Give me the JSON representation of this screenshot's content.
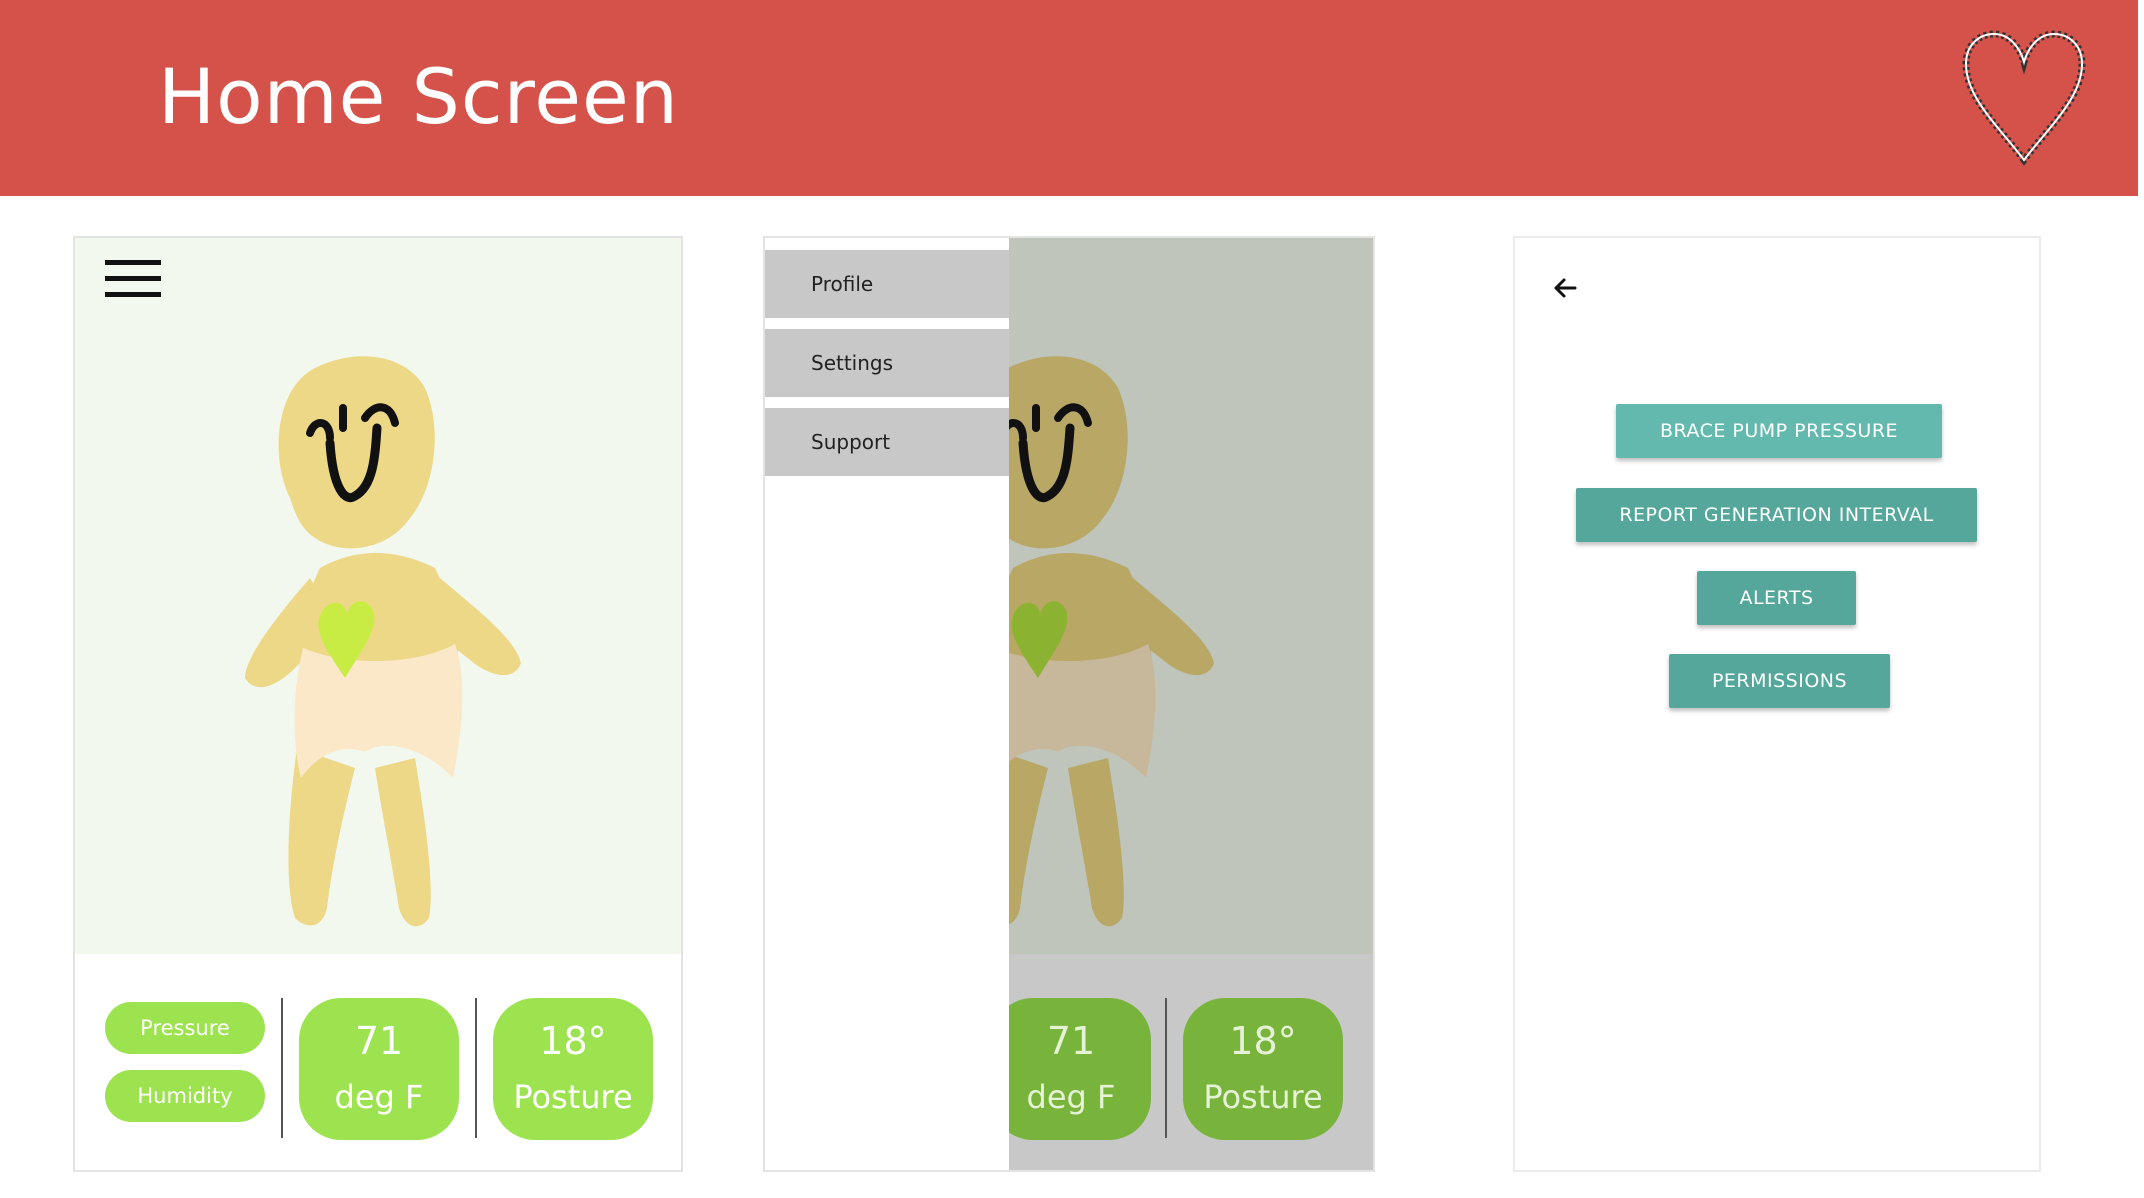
{
  "header": {
    "title": "Home Screen"
  },
  "home": {
    "pills": [
      "Pressure",
      "Humidity"
    ],
    "temperature": {
      "value": "71",
      "unit": "deg F"
    },
    "posture": {
      "value": "18°",
      "unit": "Posture"
    }
  },
  "drawer": {
    "items": [
      "Profile",
      "Settings",
      "Support"
    ]
  },
  "settings": {
    "buttons": [
      "BRACE PUMP PRESSURE",
      "REPORT GENERATION INTERVAL",
      "ALERTS",
      "PERMISSIONS"
    ]
  },
  "colors": {
    "header": "#d4524a",
    "accent_green": "#9de350",
    "button_teal": "#54a79a"
  }
}
